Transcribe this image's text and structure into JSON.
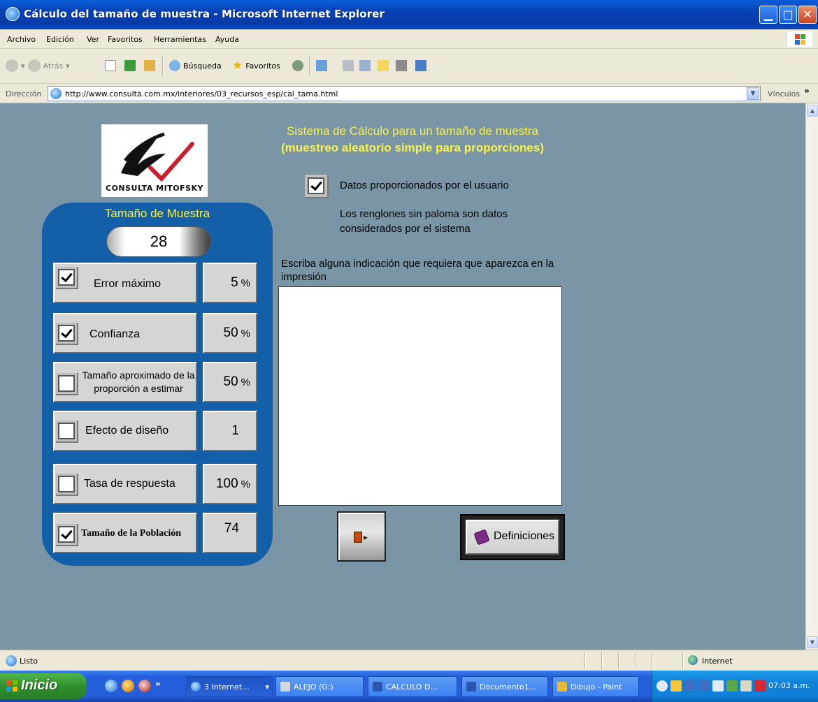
{
  "window": {
    "title": "Cálculo del tamaño de muestra - Microsoft Internet Explorer"
  },
  "menu": [
    "Archivo",
    "Edición",
    "Ver",
    "Favoritos",
    "Herramientas",
    "Ayuda"
  ],
  "toolbar": {
    "back": "Atrás",
    "search": "Búsqueda",
    "favorites": "Favoritos"
  },
  "address": {
    "label": "Dirección",
    "url": "http://www.consulta.com.mx/interiores/03_recursos_esp/cal_tama.html",
    "links": "Vínculos"
  },
  "page": {
    "logo_text": "CONSULTA MITOFSKY",
    "heading": "Sistema de Cálculo para un tamaño de muestra",
    "subheading": "(muestreo aleatorio simple para proporciones)",
    "user_data_label": "Datos proporcionados por el usuario",
    "user_data_checked": true,
    "note": "Los renglones sin paloma son datos considerados por el sistema",
    "textarea_label": "Escriba alguna indicación que requiera que aparezca en la impresión",
    "textarea_value": "",
    "panel_title": "Tamaño de Muestra",
    "sample_size": "28",
    "rows": [
      {
        "label": "Error máximo",
        "value": "5",
        "unit": "%",
        "checked": true
      },
      {
        "label": "Confianza",
        "value": "50",
        "unit": "%",
        "checked": true
      },
      {
        "label": "Tamaño aproximado de la proporción a estimar",
        "value": "50",
        "unit": "%",
        "checked": false
      },
      {
        "label": "Efecto de diseño",
        "value": "1",
        "unit": "",
        "checked": false
      },
      {
        "label": "Tasa de respuesta",
        "value": "100",
        "unit": "%",
        "checked": false
      },
      {
        "label": "Tamaño de la Población",
        "value": "74",
        "unit": "",
        "checked": true
      }
    ],
    "definitions_button": "Definiciones"
  },
  "status": {
    "text": "Listo",
    "zone": "Internet"
  },
  "taskbar": {
    "start": "Inicio",
    "tasks": [
      "3 Internet...",
      "ALEJO (G:)",
      "CALCULO D...",
      "Documento1...",
      "Dibujo - Paint"
    ],
    "clock": "07:03 a.m."
  }
}
